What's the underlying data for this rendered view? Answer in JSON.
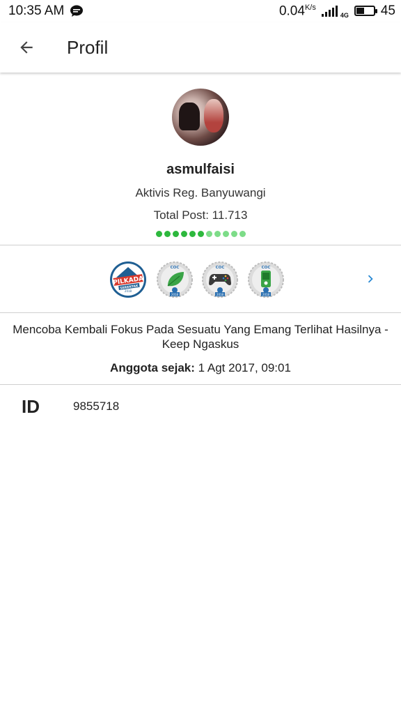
{
  "status_bar": {
    "time": "10:35 AM",
    "speed_value": "0.04",
    "speed_unit": "K/s",
    "network_type": "4G",
    "battery": "45",
    "battery_level": 0.45
  },
  "header": {
    "title": "Profil",
    "back_icon": "arrow-left-icon"
  },
  "profile": {
    "username": "asmulfaisi",
    "rank": "Aktivis Reg. Banyuwangi",
    "total_post": "Total Post: 11.713",
    "reputation_dots": {
      "filled": 6,
      "total": 11,
      "filled_color": "#2db83d",
      "empty_color": "#7ddc88"
    }
  },
  "badges": {
    "items": [
      {
        "icon": "pilkada-serentak-2018-badge-icon",
        "label": "PILKADA",
        "sublabel": "SERENTAK",
        "year": "2018"
      },
      {
        "icon": "coc-leaf-2018-badge-icon",
        "label": "COC",
        "year": "2018"
      },
      {
        "icon": "coc-gamepad-2018-badge-icon",
        "label": "COC",
        "year": "2018"
      },
      {
        "icon": "coc-phone-2018-badge-icon",
        "label": "COC",
        "year": "2018"
      }
    ],
    "next_icon": "chevron-right-icon",
    "accent_color": "#2a8ad4"
  },
  "bio": {
    "text": "Mencoba Kembali Fokus Pada Sesuatu Yang Emang Terlihat Hasilnya - Keep Ngaskus",
    "member_since_label": "Anggota sejak:",
    "member_since_value": "1 Agt 2017, 09:01"
  },
  "id_row": {
    "label": "ID",
    "value": "9855718"
  }
}
